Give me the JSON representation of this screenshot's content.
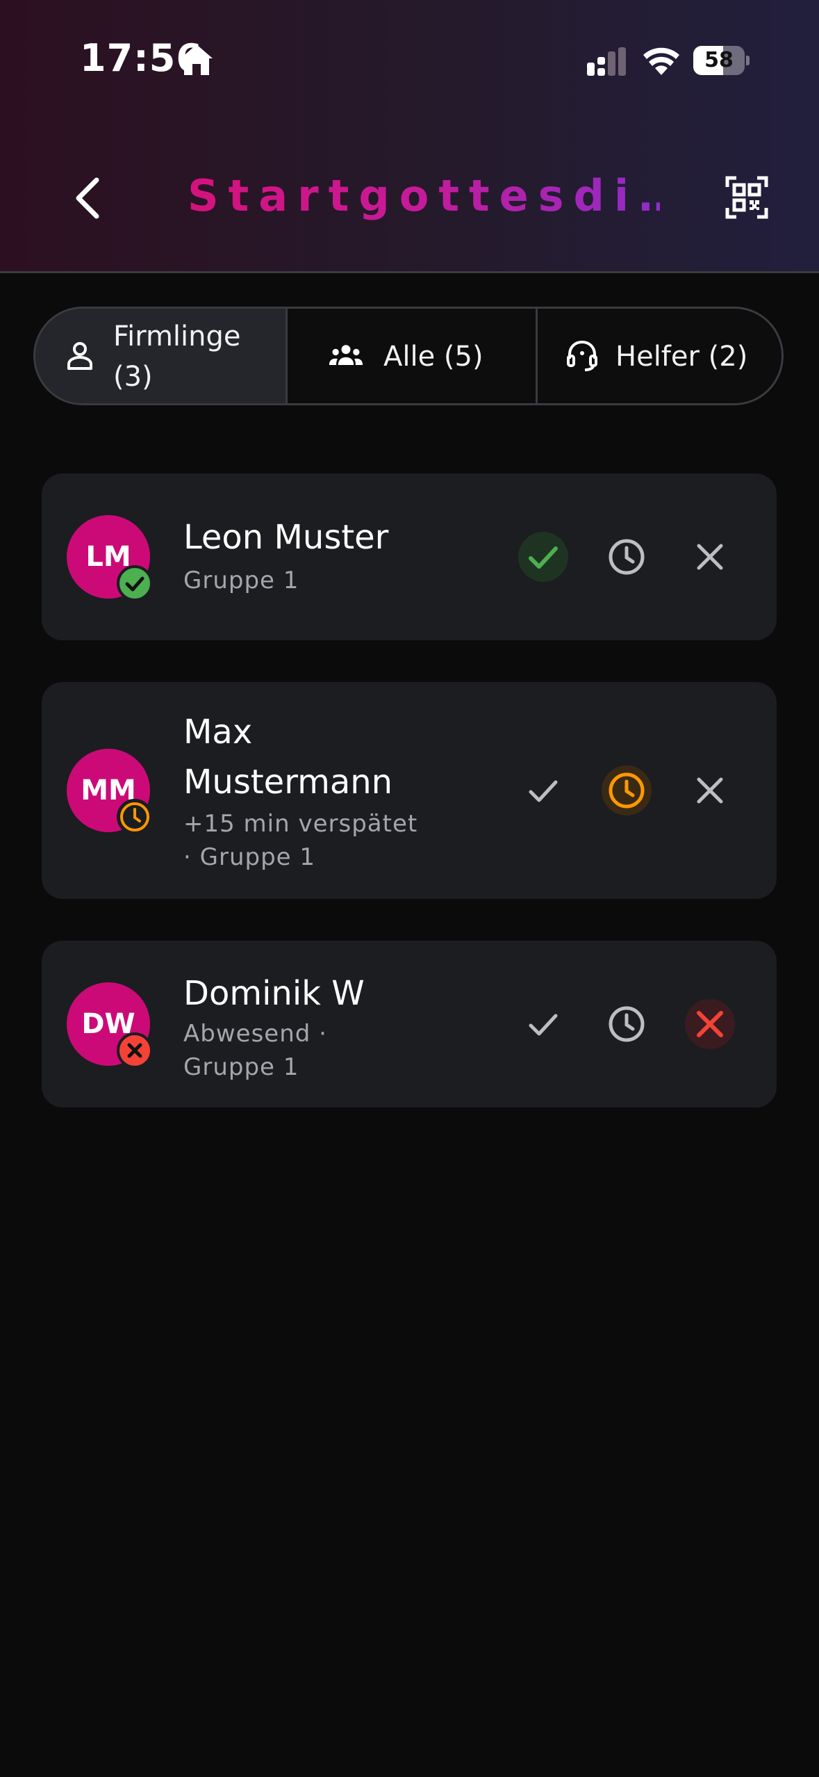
{
  "status_bar": {
    "time": "17:56",
    "battery": "58",
    "battery_level": 0.58
  },
  "header": {
    "title": "Startgottesdi…"
  },
  "tabs": [
    {
      "label_line1": "Firmlinge",
      "label_line2": "(3)",
      "icon": "person-icon",
      "active": true
    },
    {
      "label": "Alle (5)",
      "icon": "group-icon",
      "active": false
    },
    {
      "label": "Helfer (2)",
      "icon": "headset-icon",
      "active": false
    }
  ],
  "participants": [
    {
      "initials": "LM",
      "name": "Leon Muster",
      "sub_line1": "Gruppe 1",
      "status": "present",
      "colors": {
        "present": "#4caf50"
      }
    },
    {
      "initials": "MM",
      "name_line1": "Max",
      "name_line2": "Mustermann",
      "sub_line1": "+15 min verspätet",
      "sub_line2": "· Gruppe 1",
      "status": "late",
      "colors": {
        "late": "#ff9800"
      }
    },
    {
      "initials": "DW",
      "name": "Dominik W",
      "sub_line1": "Abwesend ·",
      "sub_line2": "Gruppe 1",
      "status": "absent",
      "colors": {
        "absent": "#f44336"
      }
    }
  ],
  "theme": {
    "accent_pink": "#cc0a77",
    "card_bg": "#1c1d21",
    "background": "#0b0b0c"
  }
}
